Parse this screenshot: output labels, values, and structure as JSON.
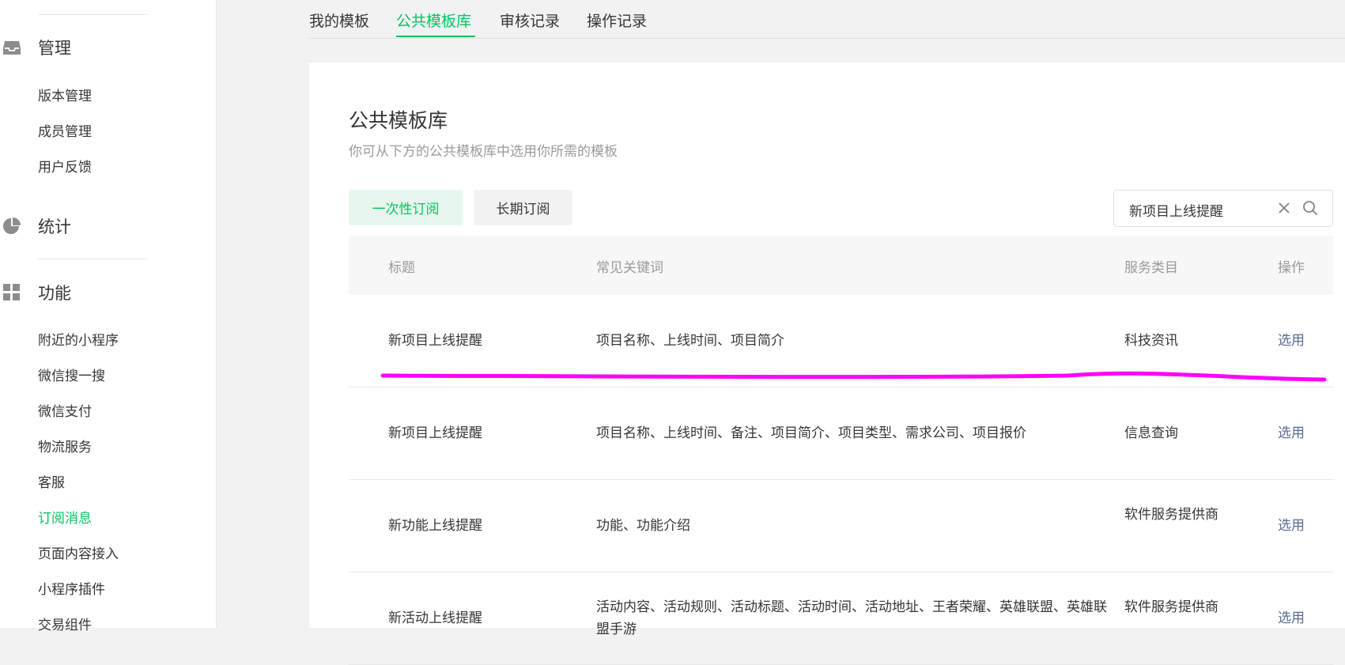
{
  "sidebar": {
    "sections": [
      {
        "label": "管理",
        "icon": "inbox-icon"
      },
      {
        "label": "统计",
        "icon": "pie-chart-icon"
      },
      {
        "label": "功能",
        "icon": "grid-icon"
      }
    ],
    "manage_items": [
      "版本管理",
      "成员管理",
      "用户反馈"
    ],
    "feature_items": [
      "附近的小程序",
      "微信搜一搜",
      "微信支付",
      "物流服务",
      "客服",
      "订阅消息",
      "页面内容接入",
      "小程序插件",
      "交易组件"
    ],
    "active_item": "订阅消息"
  },
  "tabs": [
    "我的模板",
    "公共模板库",
    "审核记录",
    "操作记录"
  ],
  "active_tab": "公共模板库",
  "page": {
    "title": "公共模板库",
    "subtitle": "你可从下方的公共模板库中选用你所需的模板"
  },
  "type_buttons": {
    "once": "一次性订阅",
    "long": "长期订阅"
  },
  "search": {
    "value": "新项目上线提醒"
  },
  "table": {
    "headers": [
      "标题",
      "常见关键词",
      "服务类目",
      "操作"
    ],
    "rows": [
      {
        "title": "新项目上线提醒",
        "keywords": "项目名称、上线时间、项目简介",
        "category": "科技资讯",
        "action": "选用"
      },
      {
        "title": "新项目上线提醒",
        "keywords": "项目名称、上线时间、备注、项目简介、项目类型、需求公司、项目报价",
        "category": "信息查询",
        "action": "选用"
      },
      {
        "title": "新功能上线提醒",
        "keywords": "功能、功能介绍",
        "category": "软件服务提供商",
        "action": "选用"
      },
      {
        "title": "新活动上线提醒",
        "keywords": "活动内容、活动规则、活动标题、活动时间、活动地址、王者荣耀、英雄联盟、英雄联盟手游",
        "category": "软件服务提供商",
        "action": "选用"
      }
    ]
  },
  "colors": {
    "accent": "#07c160",
    "link": "#576b95",
    "annotation": "#ff00ff"
  }
}
